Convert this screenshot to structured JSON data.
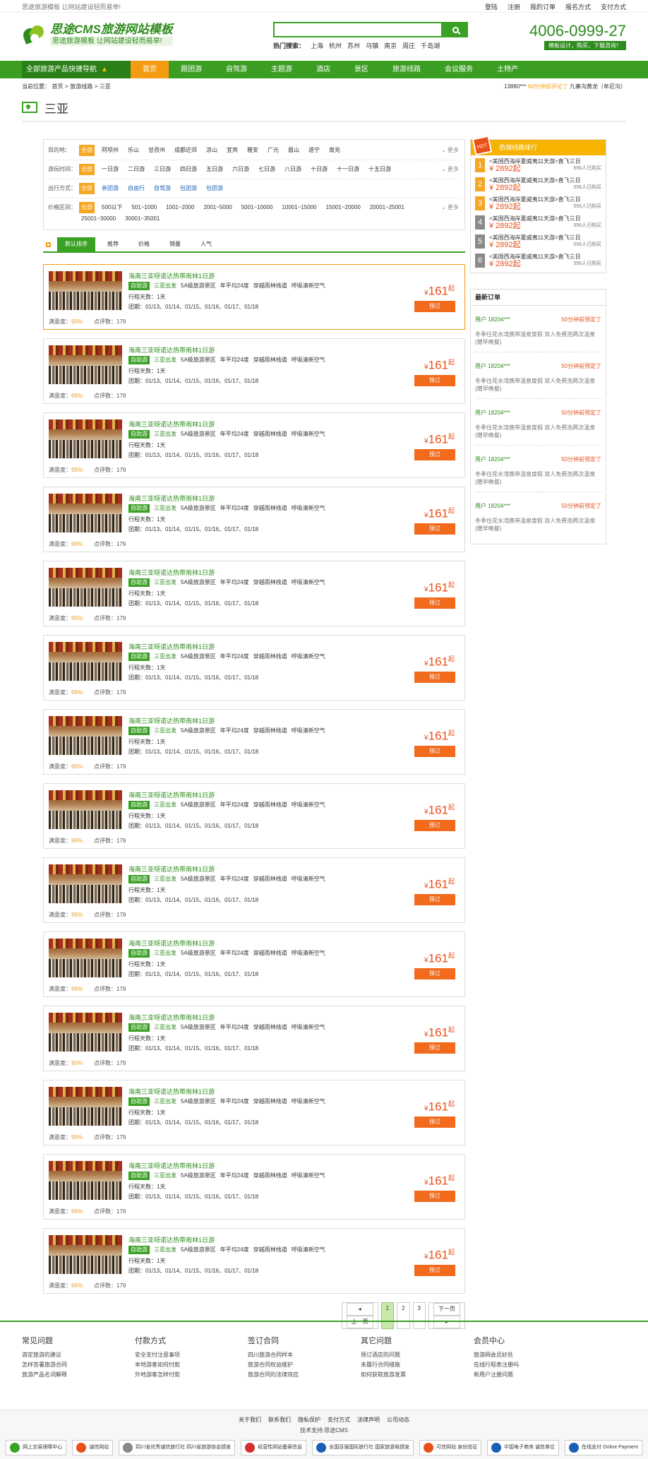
{
  "topbar": {
    "left": "思途旅游模板 让网站建设轻而易举!",
    "links": [
      "登陆",
      "注册",
      "我的订单",
      "报名方式",
      "支付方式"
    ]
  },
  "logo": {
    "name": "思途CMS旅游网站模板",
    "slogan": "思途旅游模板 让网站建设轻而易举!"
  },
  "search": {
    "placeholder": "",
    "hot_label": "热门搜索：",
    "hot": [
      "上海",
      "杭州",
      "苏州",
      "乌镇",
      "南京",
      "周庄",
      "千岛湖"
    ]
  },
  "phone": {
    "number": "4006-0999-27",
    "tagline": "模板设计，购买，下载咨询！"
  },
  "nav": {
    "all_label": "全部旅游产品快捷导航",
    "items": [
      "首页",
      "跟团游",
      "自驾游",
      "主题游",
      "酒店",
      "景区",
      "旅游线路",
      "会议服务",
      "土特产"
    ]
  },
  "crumb": {
    "label": "当前位置：",
    "path": [
      "首页",
      "旅游线路",
      "三亚"
    ],
    "sep": ">"
  },
  "ticker": {
    "user": "13880***",
    "time": "60分钟前评论了",
    "place": "九寨沟黄龙（牟尼沟）"
  },
  "page_title": "三亚",
  "filters": [
    {
      "label": "目的地：",
      "options": [
        "全部",
        "阿坝州",
        "乐山",
        "甘孜州",
        "成都近郊",
        "凉山",
        "宜宾",
        "雅安",
        "广元",
        "眉山",
        "遂宁",
        "南充"
      ],
      "active": 0,
      "more": "更多"
    },
    {
      "label": "游玩时间：",
      "options": [
        "全部",
        "一日游",
        "二日游",
        "三日游",
        "四日游",
        "五日游",
        "六日游",
        "七日游",
        "八日游",
        "十日游",
        "十一日游",
        "十五日游"
      ],
      "active": 0,
      "more": "更多"
    },
    {
      "label": "出行方式：",
      "options": [
        "全部",
        "参团游",
        "自由行",
        "自驾游",
        "包团游",
        "包团游"
      ],
      "active": 0,
      "more": ""
    },
    {
      "label": "价格区间：",
      "options": [
        "全部",
        "500以下",
        "501~1000",
        "1001~2000",
        "2001~5000",
        "5001~10000",
        "10001~15000",
        "15001~20000",
        "20001~25001",
        "25001~30000",
        "30001~35001"
      ],
      "active": 0,
      "more": "更多"
    }
  ],
  "sort": [
    "默认排序",
    "推荐",
    "价格",
    "销量",
    "人气"
  ],
  "product": {
    "name": "海南三亚呀诺达热带雨林1日游",
    "tag": "自助游",
    "dep_label": "三亚出发",
    "features": [
      "5A级旅游景区",
      "年平均24度",
      "穿越雨林栈道",
      "呼吸清新空气"
    ],
    "days_label": "行程天数：",
    "days": "1天",
    "dates_label": "团期：",
    "dates": "01/13、01/14、01/15、01/16、01/17、01/18",
    "sat_label": "满意度：",
    "sat": "95%",
    "reviews_label": "点评数：",
    "reviews": "179",
    "currency": "¥",
    "price": "161",
    "price_suffix": "起",
    "book": "预订"
  },
  "product_count": 14,
  "pager": {
    "prev": "上一页",
    "pages": [
      "1",
      "2",
      "3"
    ],
    "current": "1",
    "next": "下一页"
  },
  "hot": {
    "badge": "HOT",
    "title": "热销线路排行",
    "items": [
      {
        "n": "1",
        "title": "<美国西海岸夏威夷11天游>直飞三日",
        "price": "¥ 2892",
        "suffix": "起",
        "sold": "556人已购买"
      },
      {
        "n": "2",
        "title": "<美国西海岸夏威夷11天游>直飞三日",
        "price": "¥ 2892",
        "suffix": "起",
        "sold": "556人已购买"
      },
      {
        "n": "3",
        "title": "<美国西海岸夏威夷11天游>直飞三日",
        "price": "¥ 2892",
        "suffix": "起",
        "sold": "556人已购买"
      },
      {
        "n": "4",
        "title": "<美国西海岸夏威夷11天游>直飞三日",
        "price": "¥ 2892",
        "suffix": "起",
        "sold": "556人已购买"
      },
      {
        "n": "5",
        "title": "<美国西海岸夏威夷11天游>直飞三日",
        "price": "¥ 2892",
        "suffix": "起",
        "sold": "556人已购买"
      },
      {
        "n": "6",
        "title": "<美国西海岸夏威夷11天游>直飞三日",
        "price": "¥ 2892",
        "suffix": "起",
        "sold": "556人已购买"
      }
    ]
  },
  "orders": {
    "title": "最新订单",
    "items": [
      {
        "user": "用户 18204***",
        "when": "50分钟前预定了",
        "text": "冬季住花水湾携带温泉度假 双人免费泡两次温泉(赠早晚餐)"
      },
      {
        "user": "用户 18204***",
        "when": "50分钟前预定了",
        "text": "冬季住花水湾携带温泉度假 双人免费泡两次温泉(赠早晚餐)"
      },
      {
        "user": "用户 18204***",
        "when": "50分钟前预定了",
        "text": "冬季住花水湾携带温泉度假 双人免费泡两次温泉(赠早晚餐)"
      },
      {
        "user": "用户 18204***",
        "when": "50分钟前预定了",
        "text": "冬季住花水湾携带温泉度假 双人免费泡两次温泉(赠早晚餐)"
      },
      {
        "user": "用户 18204***",
        "when": "50分钟前预定了",
        "text": "冬季住花水湾携带温泉度假 双人免费泡两次温泉(赠早晚餐)"
      }
    ]
  },
  "footer": {
    "cols": [
      {
        "title": "常见问题",
        "links": [
          "游定旅游的建议",
          "怎样签署旅游合同",
          "旅游产品名词解释"
        ]
      },
      {
        "title": "付款方式",
        "links": [
          "安全支付注意事项",
          "本地游客如何付款",
          "外地游客怎样付款"
        ]
      },
      {
        "title": "签订合同",
        "links": [
          "四川旅游合同样本",
          "旅游合同权益维护",
          "旅游合同的法律效应"
        ]
      },
      {
        "title": "其它问题",
        "links": [
          "预订酒店的问题",
          "未履行合同措施",
          "如何获取旅游发票"
        ]
      },
      {
        "title": "会员中心",
        "links": [
          "旅游网会员好处",
          "在线行程表注册吗",
          "新用户注册问题"
        ]
      }
    ],
    "links": [
      "关于我们",
      "联系我们",
      "隐私保护",
      "支付方式",
      "法律声明",
      "公司动态"
    ],
    "tech": "技术支持:思途CMS",
    "badges": [
      "网上交易保障中心",
      "诚信网站",
      "四川省优秀诚信旅行社 四川省旅游协会颁发",
      "经营性网站备案信息",
      "全国百强国际旅行社 国家旅游局颁发",
      "可信网站 身份验证",
      "中国电子商务 诚信单位",
      "在线支付 Online Payment"
    ]
  },
  "colors": {
    "green": "#3b9e23",
    "orange": "#f39c12",
    "price": "#e8501a"
  }
}
